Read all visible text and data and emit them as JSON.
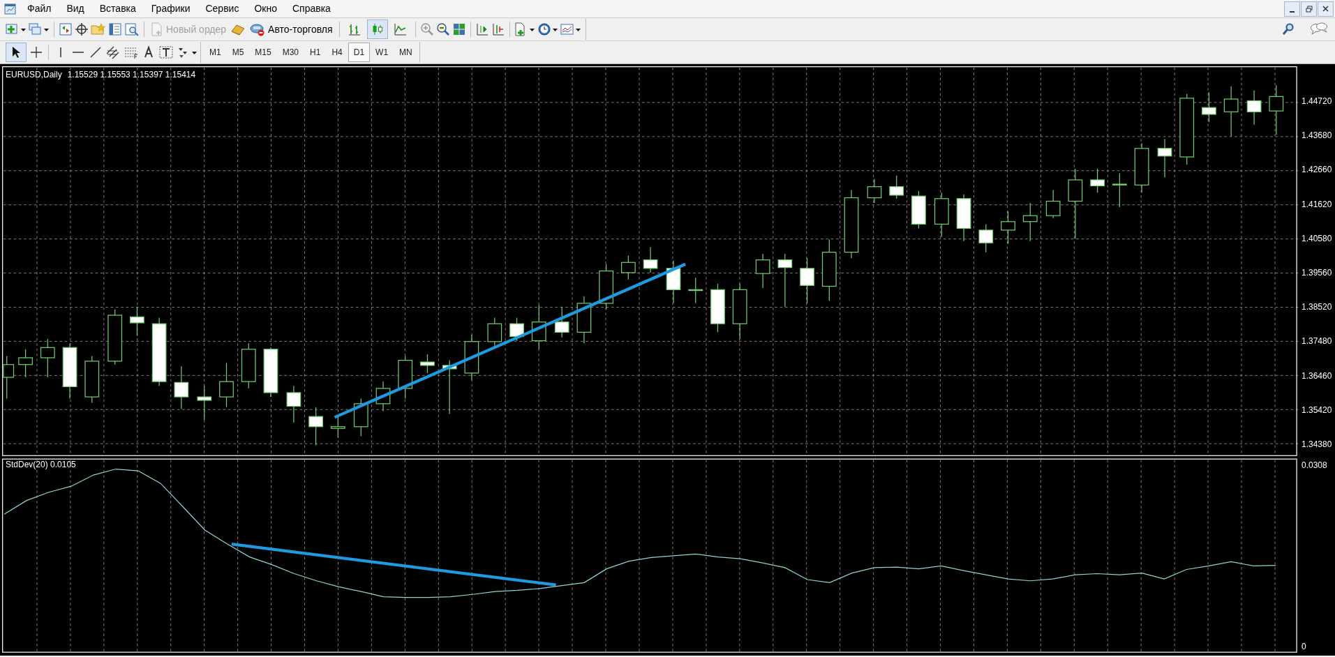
{
  "menu": {
    "items": [
      "Файл",
      "Вид",
      "Вставка",
      "Графики",
      "Сервис",
      "Окно",
      "Справка"
    ]
  },
  "toolbar": {
    "new_order": {
      "label": "Новый ордер",
      "disabled": true
    },
    "auto_trading": {
      "label": "Авто-торговля"
    },
    "chart_types": [
      {
        "selected": false
      },
      {
        "selected": true
      },
      {
        "selected": false
      }
    ]
  },
  "timeframes": [
    {
      "label": "M1",
      "selected": false
    },
    {
      "label": "M5",
      "selected": false
    },
    {
      "label": "M15",
      "selected": false
    },
    {
      "label": "M30",
      "selected": false
    },
    {
      "label": "H1",
      "selected": false
    },
    {
      "label": "H4",
      "selected": false
    },
    {
      "label": "D1",
      "selected": true
    },
    {
      "label": "W1",
      "selected": false
    },
    {
      "label": "MN",
      "selected": false
    }
  ],
  "chart": {
    "symbol": "EURUSD,Daily",
    "ohlc": "1.15529 1.15553 1.15397 1.15414",
    "price_axis": [
      "1.44720",
      "1.43680",
      "1.42660",
      "1.41620",
      "1.40580",
      "1.39560",
      "1.38520",
      "1.37480",
      "1.36460",
      "1.35420",
      "1.34380"
    ]
  },
  "indicator": {
    "chart_data": {
      "type": "line",
      "title": "StdDev(20) 0.0105",
      "ylim": [
        -0.0007,
        0.0318
      ],
      "yticks": [
        {
          "value": 0.0308,
          "label": "0.0308"
        },
        {
          "value": 0,
          "label": "0"
        }
      ],
      "series": [
        {
          "color": "#8fd3d8",
          "values": [
            0.0225,
            0.0248,
            0.0262,
            0.0272,
            0.0291,
            0.0301,
            0.0298,
            0.0277,
            0.0238,
            0.0198,
            0.0175,
            0.0153,
            0.014,
            0.0125,
            0.0113,
            0.0103,
            0.0095,
            0.0086,
            0.0085,
            0.0085,
            0.0086,
            0.009,
            0.0095,
            0.0097,
            0.01,
            0.0105,
            0.011,
            0.0133,
            0.0146,
            0.0152,
            0.0155,
            0.0158,
            0.0153,
            0.015,
            0.0143,
            0.0135,
            0.0115,
            0.011,
            0.0126,
            0.0135,
            0.0136,
            0.0133,
            0.0138,
            0.013,
            0.0123,
            0.0116,
            0.0113,
            0.0116,
            0.0123,
            0.0125,
            0.0123,
            0.0126,
            0.0116,
            0.0132,
            0.0138,
            0.0145,
            0.0138,
            0.0139
          ]
        }
      ]
    }
  }
}
